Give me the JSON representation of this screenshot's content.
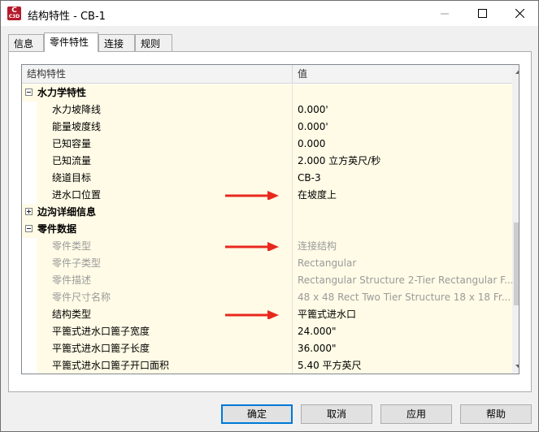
{
  "window": {
    "title": "结构特性 - CB-1",
    "app_icon_letter": "C",
    "app_icon_version": "C3D",
    "controls": [
      "minimize-icon",
      "maximize-icon",
      "close-icon"
    ]
  },
  "tabs": [
    {
      "label": "信息",
      "active": false
    },
    {
      "label": "零件特性",
      "active": true
    },
    {
      "label": "连接",
      "active": false
    },
    {
      "label": "规则",
      "active": false
    }
  ],
  "grid": {
    "headers": {
      "property": "结构特性",
      "value": "值"
    },
    "rows": [
      {
        "type": "category",
        "label": "水力学特性",
        "value": "",
        "expanded": true
      },
      {
        "type": "item",
        "label": "水力坡降线",
        "value": "0.000'"
      },
      {
        "type": "item",
        "label": "能量坡度线",
        "value": "0.000'"
      },
      {
        "type": "item",
        "label": "已知容量",
        "value": "0.000"
      },
      {
        "type": "item",
        "label": "已知流量",
        "value": "2.000 立方英尺/秒"
      },
      {
        "type": "item",
        "label": "绕道目标",
        "value": "CB-3"
      },
      {
        "type": "item",
        "label": "进水口位置",
        "value": "在坡度上",
        "highlighted": true
      },
      {
        "type": "category",
        "label": "边沟详细信息",
        "value": "",
        "expanded": false
      },
      {
        "type": "category",
        "label": "零件数据",
        "value": "",
        "expanded": true
      },
      {
        "type": "item",
        "label": "零件类型",
        "value": "连接结构",
        "disabled": true,
        "highlighted": true
      },
      {
        "type": "item",
        "label": "零件子类型",
        "value": "Rectangular",
        "disabled": true
      },
      {
        "type": "item",
        "label": "零件描述",
        "value": "Rectangular Structure 2-Tier Rectangular F...",
        "disabled": true
      },
      {
        "type": "item",
        "label": "零件尺寸名称",
        "value": "48 x 48 Rect Two Tier Structure 18 x 18 Fr...",
        "disabled": true
      },
      {
        "type": "item",
        "label": "结构类型",
        "value": "平篦式进水口",
        "highlighted": true
      },
      {
        "type": "item",
        "label": "平篦式进水口篦子宽度",
        "value": "24.000\""
      },
      {
        "type": "item",
        "label": "平篦式进水口篦子长度",
        "value": "36.000\""
      },
      {
        "type": "item",
        "label": "平篦式进水口篦子开口面积",
        "value": "5.40 平方英尺"
      }
    ]
  },
  "annotation_color": "#e8281e",
  "buttons": {
    "ok": "确定",
    "cancel": "取消",
    "apply": "应用",
    "help": "帮助"
  }
}
